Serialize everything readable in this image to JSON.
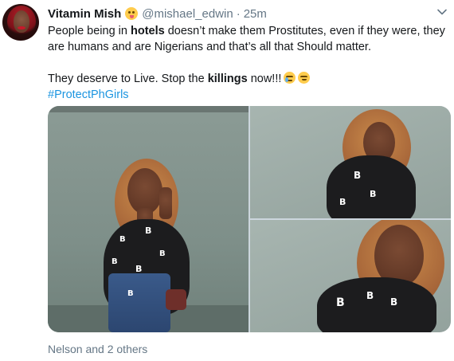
{
  "tweet": {
    "name": "Vitamin Mish",
    "handle": "@mishael_edwin",
    "separator": "·",
    "time": "25m",
    "line1_pre": "People being in ",
    "line1_bold": "hotels",
    "line1_post": " doesn’t make them Prostitutes, even if they were, they are humans and are Nigerians and that’s all that Should matter.",
    "line2_pre": "They deserve to Live. Stop the ",
    "line2_bold": "killings",
    "line2_post": " now!!!",
    "hashtag": "#ProtectPhGirls",
    "emoji_after_name": "face-savoring-food-emoji",
    "emojis_after_text": [
      "crying-face-emoji",
      "relieved-face-emoji"
    ],
    "footer": "Nelson and 2 others"
  },
  "colors": {
    "text": "#14171a",
    "muted": "#657786",
    "link": "#1b95e0"
  },
  "icons": {
    "more": "chevron-down-icon"
  }
}
